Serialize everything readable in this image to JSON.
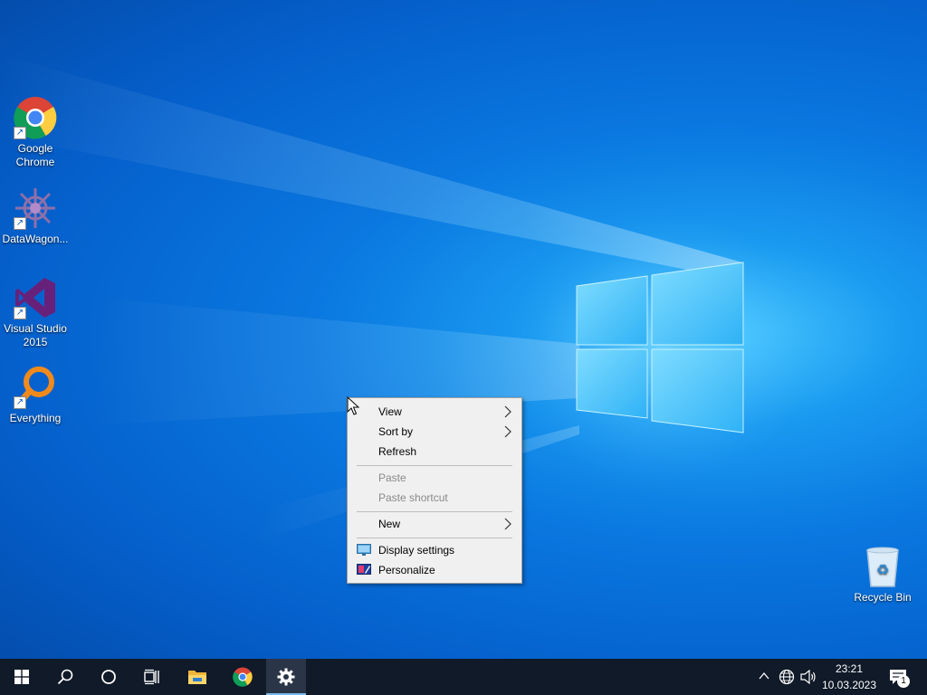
{
  "desktop": {
    "icons": [
      {
        "label": "Google Chrome",
        "icon": "chrome-icon"
      },
      {
        "label": "DataWagon...",
        "icon": "datawagon-icon"
      },
      {
        "label": "Visual Studio 2015",
        "icon": "visual-studio-icon"
      },
      {
        "label": "Everything",
        "icon": "everything-search-icon"
      },
      {
        "label": "Recycle Bin",
        "icon": "recycle-bin-icon"
      }
    ]
  },
  "context_menu": {
    "items": [
      {
        "label": "View",
        "has_submenu": true,
        "enabled": true
      },
      {
        "label": "Sort by",
        "has_submenu": true,
        "enabled": true
      },
      {
        "label": "Refresh",
        "has_submenu": false,
        "enabled": true
      },
      {
        "label": "Paste",
        "has_submenu": false,
        "enabled": false
      },
      {
        "label": "Paste shortcut",
        "has_submenu": false,
        "enabled": false
      },
      {
        "label": "New",
        "has_submenu": true,
        "enabled": true
      },
      {
        "label": "Display settings",
        "has_submenu": false,
        "enabled": true,
        "icon": "display-settings-icon"
      },
      {
        "label": "Personalize",
        "has_submenu": false,
        "enabled": true,
        "icon": "personalize-icon"
      }
    ]
  },
  "taskbar": {
    "buttons": [
      {
        "icon": "windows-start-icon"
      },
      {
        "icon": "search-icon"
      },
      {
        "icon": "cortana-icon"
      },
      {
        "icon": "task-view-icon"
      },
      {
        "icon": "file-explorer-icon"
      },
      {
        "icon": "chrome-icon"
      },
      {
        "icon": "settings-gear-icon",
        "active": true
      }
    ],
    "tray": {
      "time": "23:21",
      "date": "10.03.2023",
      "notification_count": "1"
    }
  },
  "colors": {
    "taskbar_bg": "#101a28",
    "menu_bg": "#f0f0f0",
    "accent": "#76b9ed"
  }
}
